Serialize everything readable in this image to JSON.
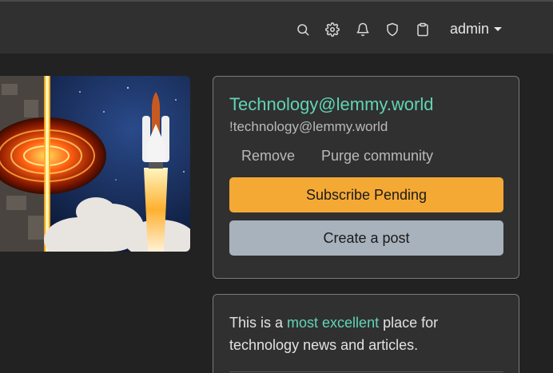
{
  "navbar": {
    "icons": [
      "search-icon",
      "gear-icon",
      "bell-icon",
      "shield-icon",
      "clipboard-icon"
    ],
    "username": "admin"
  },
  "community": {
    "title": "Technology@lemmy.world",
    "handle": "!technology@lemmy.world",
    "actions": {
      "remove_label": "Remove",
      "purge_label": "Purge community"
    },
    "subscribe_label": "Subscribe Pending",
    "create_post_label": "Create a post"
  },
  "description": {
    "text_before": "This is a ",
    "link_text": "most excellent",
    "text_after": " place for technology news and articles."
  },
  "colors": {
    "accent": "#61d4b3",
    "subscribe_button": "#f5a935",
    "secondary_button": "#a8b2bd",
    "background": "#222222",
    "card": "#303030"
  }
}
